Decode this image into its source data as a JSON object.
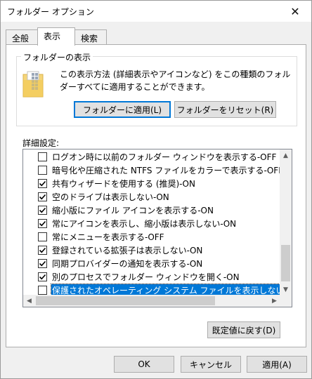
{
  "window": {
    "title": "フォルダー オプション",
    "close_glyph": "✕"
  },
  "tabs": [
    {
      "label": "全般"
    },
    {
      "label": "表示"
    },
    {
      "label": "検索"
    }
  ],
  "folder_view": {
    "legend": "フォルダーの表示",
    "description": "この表示方法 (詳細表示やアイコンなど) をこの種類のフォルダーすべてに適用することができます。",
    "apply_button": "フォルダーに適用(L)",
    "reset_button": "フォルダーをリセット(R)"
  },
  "advanced": {
    "label": "詳細設定:",
    "items": [
      {
        "label": "ログオン時に以前のフォルダー ウィンドウを表示する-OFF",
        "checked": false
      },
      {
        "label": "暗号化や圧縮された NTFS ファイルをカラーで表示する-OFF",
        "checked": false
      },
      {
        "label": "共有ウィザードを使用する (推奨)-ON",
        "checked": true
      },
      {
        "label": "空のドライブは表示しない-ON",
        "checked": true
      },
      {
        "label": "縮小版にファイル アイコンを表示する-ON",
        "checked": true
      },
      {
        "label": "常にアイコンを表示し、縮小版は表示しない-ON",
        "checked": true
      },
      {
        "label": "常にメニューを表示する-OFF",
        "checked": false
      },
      {
        "label": "登録されている拡張子は表示しない-ON",
        "checked": true
      },
      {
        "label": "同期プロバイダーの通知を表示する-ON",
        "checked": true
      },
      {
        "label": "別のプロセスでフォルダー ウィンドウを開く-ON",
        "checked": true
      },
      {
        "label": "保護されたオペレーティング システム ファイルを表示しない (推奨)-OFF",
        "checked": false,
        "selected": true
      }
    ]
  },
  "restore_button": "既定値に戻す(D)",
  "footer": {
    "ok": "OK",
    "cancel": "キャンセル",
    "apply": "適用(A)"
  },
  "colors": {
    "selection": "#0078d7",
    "focus_border": "#0078d7"
  }
}
